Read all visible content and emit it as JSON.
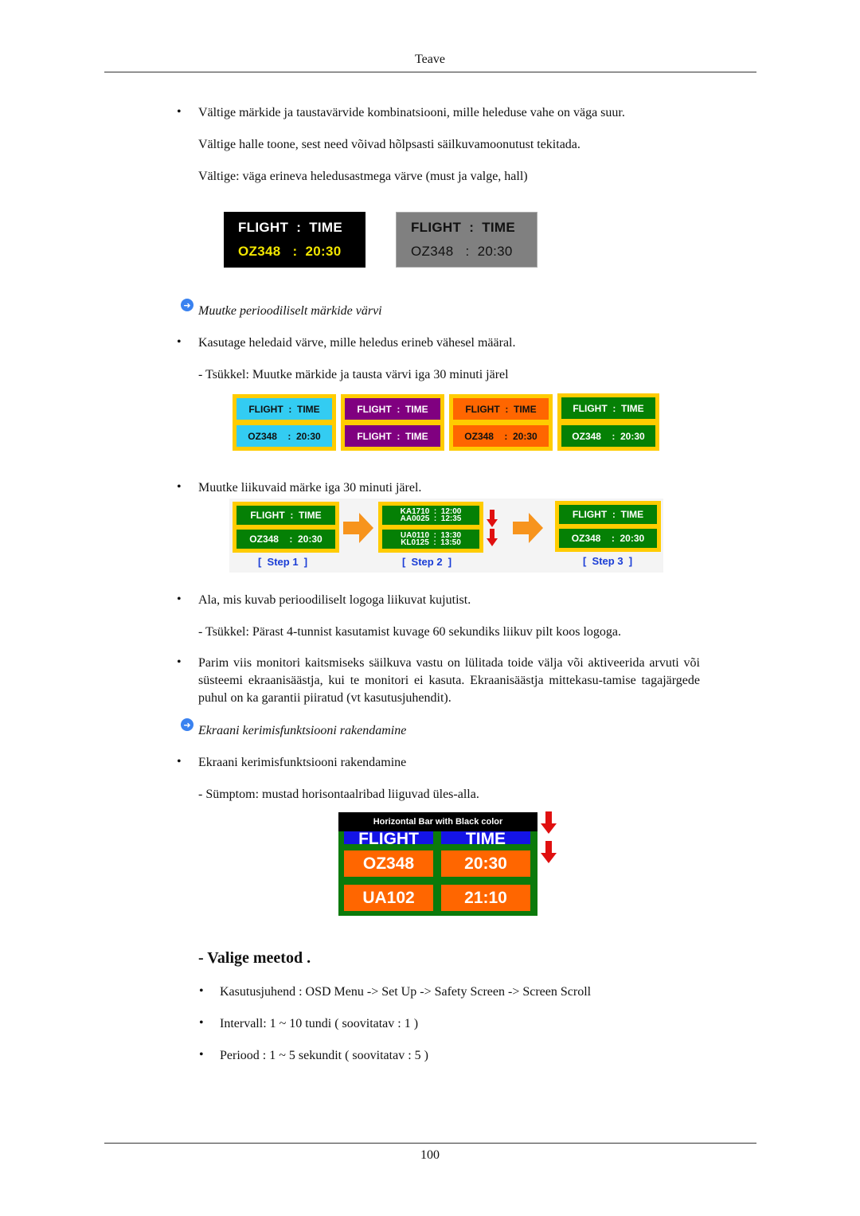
{
  "header": {
    "title": "Teave"
  },
  "footer": {
    "page_number": "100"
  },
  "section1": {
    "bullet": "Vältige märkide ja taustavärvide kombinatsiooni, mille heleduse vahe on väga suur.",
    "line2": "Vältige halle toone, sest need võivad hõlpsasti säilkuvamoonutust tekitada.",
    "line3": "Vältige: väga erineva heledusastmega värve (must ja valge, hall)",
    "signs": [
      {
        "row1": "FLIGHT  :  TIME",
        "row2": "OZ348   :  20:30",
        "bg": "#000000",
        "fg1": "#ffffff",
        "fg2": "#f2e600"
      },
      {
        "row1": "FLIGHT  :  TIME",
        "row2": "OZ348   :  20:30",
        "bg": "#808080",
        "fg1": "#111111",
        "fg2": "#111111"
      }
    ]
  },
  "section2": {
    "title": "Muutke perioodiliselt märkide värvi",
    "bullet": "Kasutage heledaid värve, mille heledus erineb vähesel määral.",
    "cycle": "- Tsükkel: Muutke märkide ja tausta värvi iga 30 minuti järel",
    "frames": [
      {
        "top": "FLIGHT  :  TIME",
        "bottom": "OZ348    :  20:30",
        "bg": "#33ccf2",
        "fg": "#111111"
      },
      {
        "top": "FLIGHT  :  TIME",
        "bottom": "FLIGHT  :  TIME",
        "bg": "#800080",
        "fg": "#ffffff"
      },
      {
        "top": "FLIGHT  :  TIME",
        "bottom": "OZ348    :  20:30",
        "bg": "#ff6600",
        "fg": "#111111"
      },
      {
        "top": "FLIGHT  :  TIME",
        "bottom": "OZ348    :  20:30",
        "bg": "#058005",
        "fg": "#ffffff"
      }
    ],
    "frame_border_color": "#ffcc00"
  },
  "section3": {
    "bullet": "Muutke liikuvaid märke iga 30 minuti järel.",
    "steps": [
      {
        "label": "[  Step 1  ]",
        "top": "FLIGHT  :  TIME",
        "bottom": "OZ348    :  20:30"
      },
      {
        "label": "[  Step 2  ]",
        "top": "KA1710  :  12:00\nAA0025  :  12:35",
        "bottom": "UA0110  :  13:30\nKL0125  :  13:50"
      },
      {
        "label": "[  Step 3  ]",
        "top": "FLIGHT  :  TIME",
        "bottom": "OZ348    :  20:30"
      }
    ],
    "step_label_color": "#1a3dd6",
    "arrow_color": "#f7941d",
    "down_arrow_color": "#e01010"
  },
  "section4": {
    "bullet": "Ala, mis kuvab perioodiliselt logoga liikuvat kujutist.",
    "cycle": "- Tsükkel: Pärast 4-tunnist kasutamist kuvage 60 sekundiks liikuv pilt koos logoga."
  },
  "section5": {
    "bullet": "Parim viis monitori kaitsmiseks säilkuva vastu on lülitada toide välja või aktiveerida arvuti või süsteemi ekraanisäästja, kui te monitori ei kasuta. Ekraanisäästja mittekasu-tamise tagajärgede puhul on ka garantii piiratud (vt kasutusjuhendit)."
  },
  "section6": {
    "title": "Ekraani kerimisfunktsiooni rakendamine",
    "bullet": "Ekraani kerimisfunktsiooni rakendamine",
    "symptom": "- Sümptom: mustad horisontaalribad liiguvad üles-alla.",
    "board": {
      "bar_label": "Horizontal Bar with Black color",
      "header_left": "FLIGHT",
      "header_right": "TIME",
      "rows": [
        {
          "flight": "OZ348",
          "time": "20:30"
        },
        {
          "flight": "UA102",
          "time": "21:10"
        }
      ],
      "board_color": "#0b7a0b",
      "header_color": "#1414e6",
      "cell_color": "#ff6600"
    }
  },
  "method": {
    "heading": "- Valige meetod .",
    "items": [
      "Kasutusjuhend : OSD Menu -> Set Up -> Safety Screen -> Screen Scroll",
      "Intervall: 1 ~ 10 tundi ( soovitatav : 1 )",
      "Periood : 1 ~ 5 sekundit ( soovitatav : 5 )"
    ]
  },
  "bullet_glyph": "•",
  "icons": {
    "section_marker": "arrow-right-circle-icon"
  }
}
